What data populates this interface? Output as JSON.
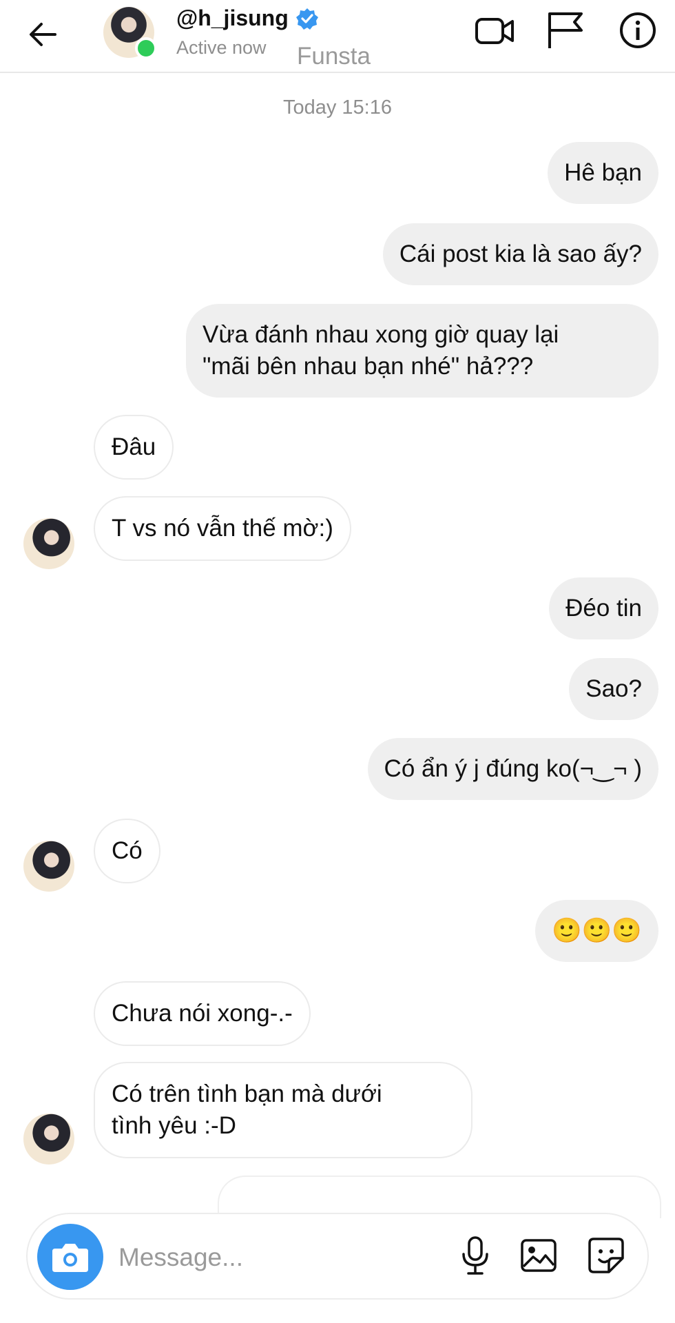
{
  "header": {
    "username": "@h_jisung",
    "status": "Active now",
    "subtitle": "Funsta"
  },
  "conversation": {
    "timestamp": "Today 15:16",
    "messages": [
      {
        "from": "me",
        "text": "Hê bạn"
      },
      {
        "from": "me",
        "text": "Cái post kia là sao ấy?"
      },
      {
        "from": "me",
        "text": "Vừa đánh nhau xong giờ quay lại\n\"mãi bên nhau bạn nhé\" hả???"
      },
      {
        "from": "them",
        "text": "Đâu"
      },
      {
        "from": "them",
        "text": "T vs nó vẫn thế mờ:)"
      },
      {
        "from": "me",
        "text": "Đéo tin"
      },
      {
        "from": "me",
        "text": "Sao?"
      },
      {
        "from": "me",
        "text": "Có ẩn ý j đúng ko(¬‿¬ )"
      },
      {
        "from": "them",
        "text": "Có"
      },
      {
        "from": "me",
        "text": "🙂🙂🙂"
      },
      {
        "from": "them",
        "text": "Chưa nói xong-.-"
      },
      {
        "from": "them",
        "text": "Có trên tình bạn mà dưới\ntình yêu :-D"
      }
    ]
  },
  "composer": {
    "placeholder": "Message..."
  },
  "colors": {
    "accent": "#3897f0",
    "online": "#2ecc59",
    "outgoing_bubble": "#efefef"
  },
  "icons": [
    "back-arrow-icon",
    "verified-badge-icon",
    "video-call-icon",
    "flag-icon",
    "info-icon",
    "camera-icon",
    "microphone-icon",
    "gallery-icon",
    "sticker-icon"
  ]
}
